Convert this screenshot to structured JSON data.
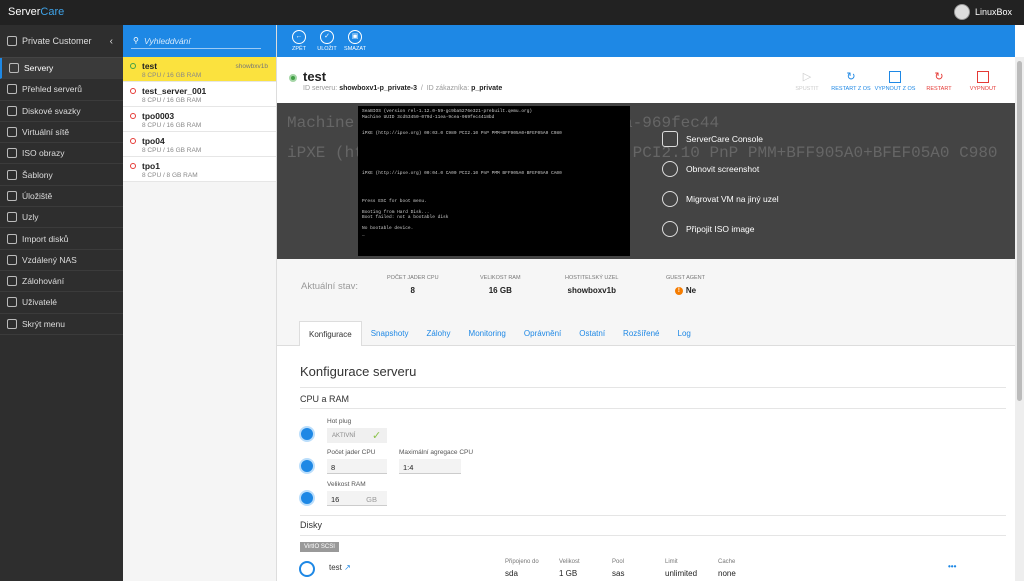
{
  "app": {
    "brand_a": "Server",
    "brand_b": "Care",
    "user": "LinuxBox"
  },
  "sidebar": {
    "customer": "Private Customer",
    "items": [
      {
        "label": "Servery",
        "icon": "server-icon",
        "active": true
      },
      {
        "label": "Přehled serverů",
        "icon": "refresh-icon"
      },
      {
        "label": "Diskové svazky",
        "icon": "disk-icon"
      },
      {
        "label": "Virtuální sítě",
        "icon": "network-icon"
      },
      {
        "label": "ISO obrazy",
        "icon": "iso-icon"
      },
      {
        "label": "Šablony",
        "icon": "template-icon"
      },
      {
        "label": "Úložiště",
        "icon": "storage-icon"
      },
      {
        "label": "Uzly",
        "icon": "node-icon"
      },
      {
        "label": "Import disků",
        "icon": "import-icon"
      },
      {
        "label": "Vzdálený NAS",
        "icon": "nas-icon"
      },
      {
        "label": "Zálohování",
        "icon": "backup-icon"
      },
      {
        "label": "Uživatelé",
        "icon": "users-icon"
      },
      {
        "label": "Skrýt menu",
        "icon": "chevron-left-icon"
      }
    ]
  },
  "search": {
    "placeholder": "Vyhleddvání"
  },
  "vms": [
    {
      "name": "test",
      "spec": "8 CPU / 16 GB RAM",
      "host": "showbxv1b",
      "selected": true
    },
    {
      "name": "test_server_001",
      "spec": "8 CPU / 16 GB RAM",
      "host": ""
    },
    {
      "name": "tpo0003",
      "spec": "8 CPU / 16 GB RAM",
      "host": ""
    },
    {
      "name": "tpo04",
      "spec": "8 CPU / 16 GB RAM",
      "host": ""
    },
    {
      "name": "tpo1",
      "spec": "8 CPU / 8 GB RAM",
      "host": ""
    }
  ],
  "toolbar": {
    "back": "ZPĚT",
    "save": "ULOŽIT",
    "delete": "SMAZAT"
  },
  "vm": {
    "title": "test",
    "id_label": "ID serveru:",
    "id_value": "showboxv1-p_private-3",
    "cust_label": "ID zákazníka:",
    "cust_value": "p_private"
  },
  "actions": {
    "start": "SPUSTIT",
    "restart_os": "RESTART Z OS",
    "shutdown_os": "VYPNOUT Z OS",
    "restart": "RESTART",
    "shutdown": "VYPNOUT"
  },
  "console": {
    "text": "SeaBIOS (version rel-1.12.0-59-gc9ba5276e321-prebuilt.qemu.org)\nMachine UUID 3cd53450-079d-11ea-9cea-969fec4418bd\n\n\niPXE (http://ipxe.org) 00:03.0 C980 PCI2.10 PnP PMM+BFF905A0+BFEF05A0 C980\n\n\n\n\n\n\niPXE (http://ipxe.org) 00:04.0 CA00 PCI2.10 PnP PMM BFF905A0 BFEF05A0 CA00\n\n\n\n\nPress ESC for boot menu.\n\nBooting from Hard Disk...\nBoot failed: not a bootable disk\n\nNo bootable device.\n_",
    "menu": [
      "ServerCare Console",
      "Obnovit screenshot",
      "Migrovat VM na jiný uzel",
      "Připojit ISO image"
    ]
  },
  "state": {
    "label": "Aktuální stav:",
    "cpu_label": "POČET JADER CPU",
    "cpu": "8",
    "ram_label": "VELIKOST RAM",
    "ram": "16 GB",
    "host_label": "HOSTITELSKÝ UZEL",
    "host": "showboxv1b",
    "agent_label": "GUEST AGENT",
    "agent": "Ne"
  },
  "tabs": [
    "Konfigurace",
    "Snapshoty",
    "Zálohy",
    "Monitoring",
    "Oprávnění",
    "Ostatní",
    "Rozšířené",
    "Log"
  ],
  "config": {
    "title": "Konfigurace serveru",
    "cpu_ram_title": "CPU a RAM",
    "hotplug_label": "Hot plug",
    "hotplug_value": "AKTIVNÍ",
    "cpu_label": "Počet jader CPU",
    "cpu_value": "8",
    "agg_label": "Maximální agregace CPU",
    "agg_value": "1:4",
    "ram_label": "Velikost RAM",
    "ram_value": "16",
    "ram_unit": "GB",
    "disks_title": "Disky",
    "disk_tag": "VirtIO SCSI",
    "disk": {
      "name": "test",
      "attached_label": "Připojeno do",
      "attached": "sda",
      "size_label": "Velikost",
      "size": "1 GB",
      "pool_label": "Pool",
      "pool": "sas",
      "limit_label": "Limit",
      "limit": "unlimited",
      "cache_label": "Cache",
      "cache": "none"
    }
  }
}
